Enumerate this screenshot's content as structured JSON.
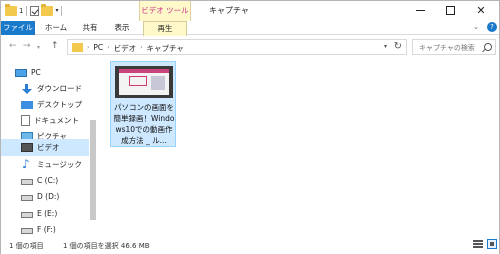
{
  "titlebar": {
    "qat_number": "1",
    "context_tab_group": "ビデオ ツール",
    "window_title": "キャプチャ",
    "close_glyph": "✕"
  },
  "ribbon": {
    "tabs": [
      {
        "label": "ファイル"
      },
      {
        "label": "ホーム"
      },
      {
        "label": "共有"
      },
      {
        "label": "表示"
      },
      {
        "label": "再生"
      }
    ],
    "help_glyph": "?"
  },
  "navigation": {
    "back_glyph": "←",
    "forward_glyph": "→",
    "up_glyph": "↑",
    "breadcrumbs": [
      "PC",
      "ビデオ",
      "キャプチャ"
    ],
    "search_placeholder": "キャプチャの検索"
  },
  "sidebar": {
    "items": [
      {
        "label": "PC",
        "icon": "pc-icon"
      },
      {
        "label": "ダウンロード",
        "icon": "download-icon"
      },
      {
        "label": "デスクトップ",
        "icon": "desktop-icon"
      },
      {
        "label": "ドキュメント",
        "icon": "document-icon"
      },
      {
        "label": "ピクチャ",
        "icon": "pictures-icon"
      },
      {
        "label": "ビデオ",
        "icon": "videos-icon",
        "selected": true
      },
      {
        "label": "ミュージック",
        "icon": "music-icon"
      },
      {
        "label": "C (C:)",
        "icon": "drive-icon"
      },
      {
        "label": "D (D:)",
        "icon": "drive-icon"
      },
      {
        "label": "E (E:)",
        "icon": "drive-icon"
      },
      {
        "label": "F (F:)",
        "icon": "drive-icon"
      }
    ]
  },
  "files": [
    {
      "name": "パソコンの画面を簡単録画！Windows10での動画作成方法 _ ル...",
      "type": "video",
      "selected": true
    }
  ],
  "status": {
    "item_count": "1 個の項目",
    "selection": "1 個の項目を選択  46.6 MB"
  },
  "colors": {
    "accent": "#1979ca",
    "selection": "#cde8ff",
    "context_tab": "#fff8c8",
    "context_tab_text": "#c8308a"
  }
}
